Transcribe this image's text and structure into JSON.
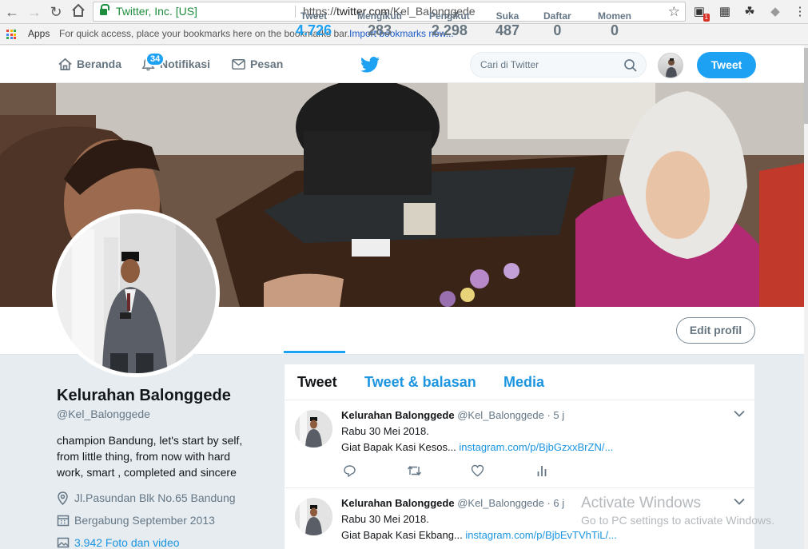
{
  "browser": {
    "secure_org": "Twitter, Inc. [US]",
    "url_prefix": "https://",
    "url_host": "twitter.com",
    "url_path": "/Kel_Balonggede",
    "apps_label": "Apps",
    "bookmarks_hint": "For quick access, place your bookmarks here on the bookmarks bar.",
    "bookmarks_link": "Import bookmarks now...",
    "extension_badge": "1"
  },
  "twitter_nav": {
    "home": "Beranda",
    "notifications": "Notifikasi",
    "notifications_count": "34",
    "messages": "Pesan",
    "search_placeholder": "Cari di Twitter",
    "tweet_button": "Tweet",
    "brand_color": "#1da1f2"
  },
  "profile_nav": {
    "stats": [
      {
        "label": "Tweet",
        "value": "4.726"
      },
      {
        "label": "Mengikuti",
        "value": "283"
      },
      {
        "label": "Pengikut",
        "value": "2.298"
      },
      {
        "label": "Suka",
        "value": "487"
      },
      {
        "label": "Daftar",
        "value": "0"
      },
      {
        "label": "Momen",
        "value": "0"
      }
    ],
    "edit_button": "Edit profil"
  },
  "profile": {
    "name": "Kelurahan Balonggede",
    "handle": "@Kel_Balonggede",
    "bio_lines": [
      "champion Bandung, let's start by self,",
      "from little thing, from now with hard",
      "work, smart , completed and sincere"
    ],
    "location": "Jl.Pasundan Blk No.65 Bandung",
    "joined": "Bergabung September 2013",
    "media": "3.942 Foto dan video"
  },
  "timeline": {
    "tabs": [
      "Tweet",
      "Tweet & balasan",
      "Media"
    ],
    "tweets": [
      {
        "name": "Kelurahan Balonggede",
        "handle": "@Kel_Balonggede",
        "time": "· 5 j",
        "line1": "Rabu 30 Mei 2018.",
        "line2_text": "Giat Bapak Kasi Kesos... ",
        "line2_link": "instagram.com/p/BjbGzxxBrZN/..."
      },
      {
        "name": "Kelurahan Balonggede",
        "handle": "@Kel_Balonggede",
        "time": "· 6 j",
        "line1": "Rabu 30 Mei 2018.",
        "line2_text": "Giat Bapak Kasi Ekbang... ",
        "line2_link": "instagram.com/p/BjbEvTVhTiL/..."
      }
    ]
  },
  "watermark": {
    "title": "Activate Windows",
    "subtitle": "Go to PC settings to activate Windows."
  }
}
